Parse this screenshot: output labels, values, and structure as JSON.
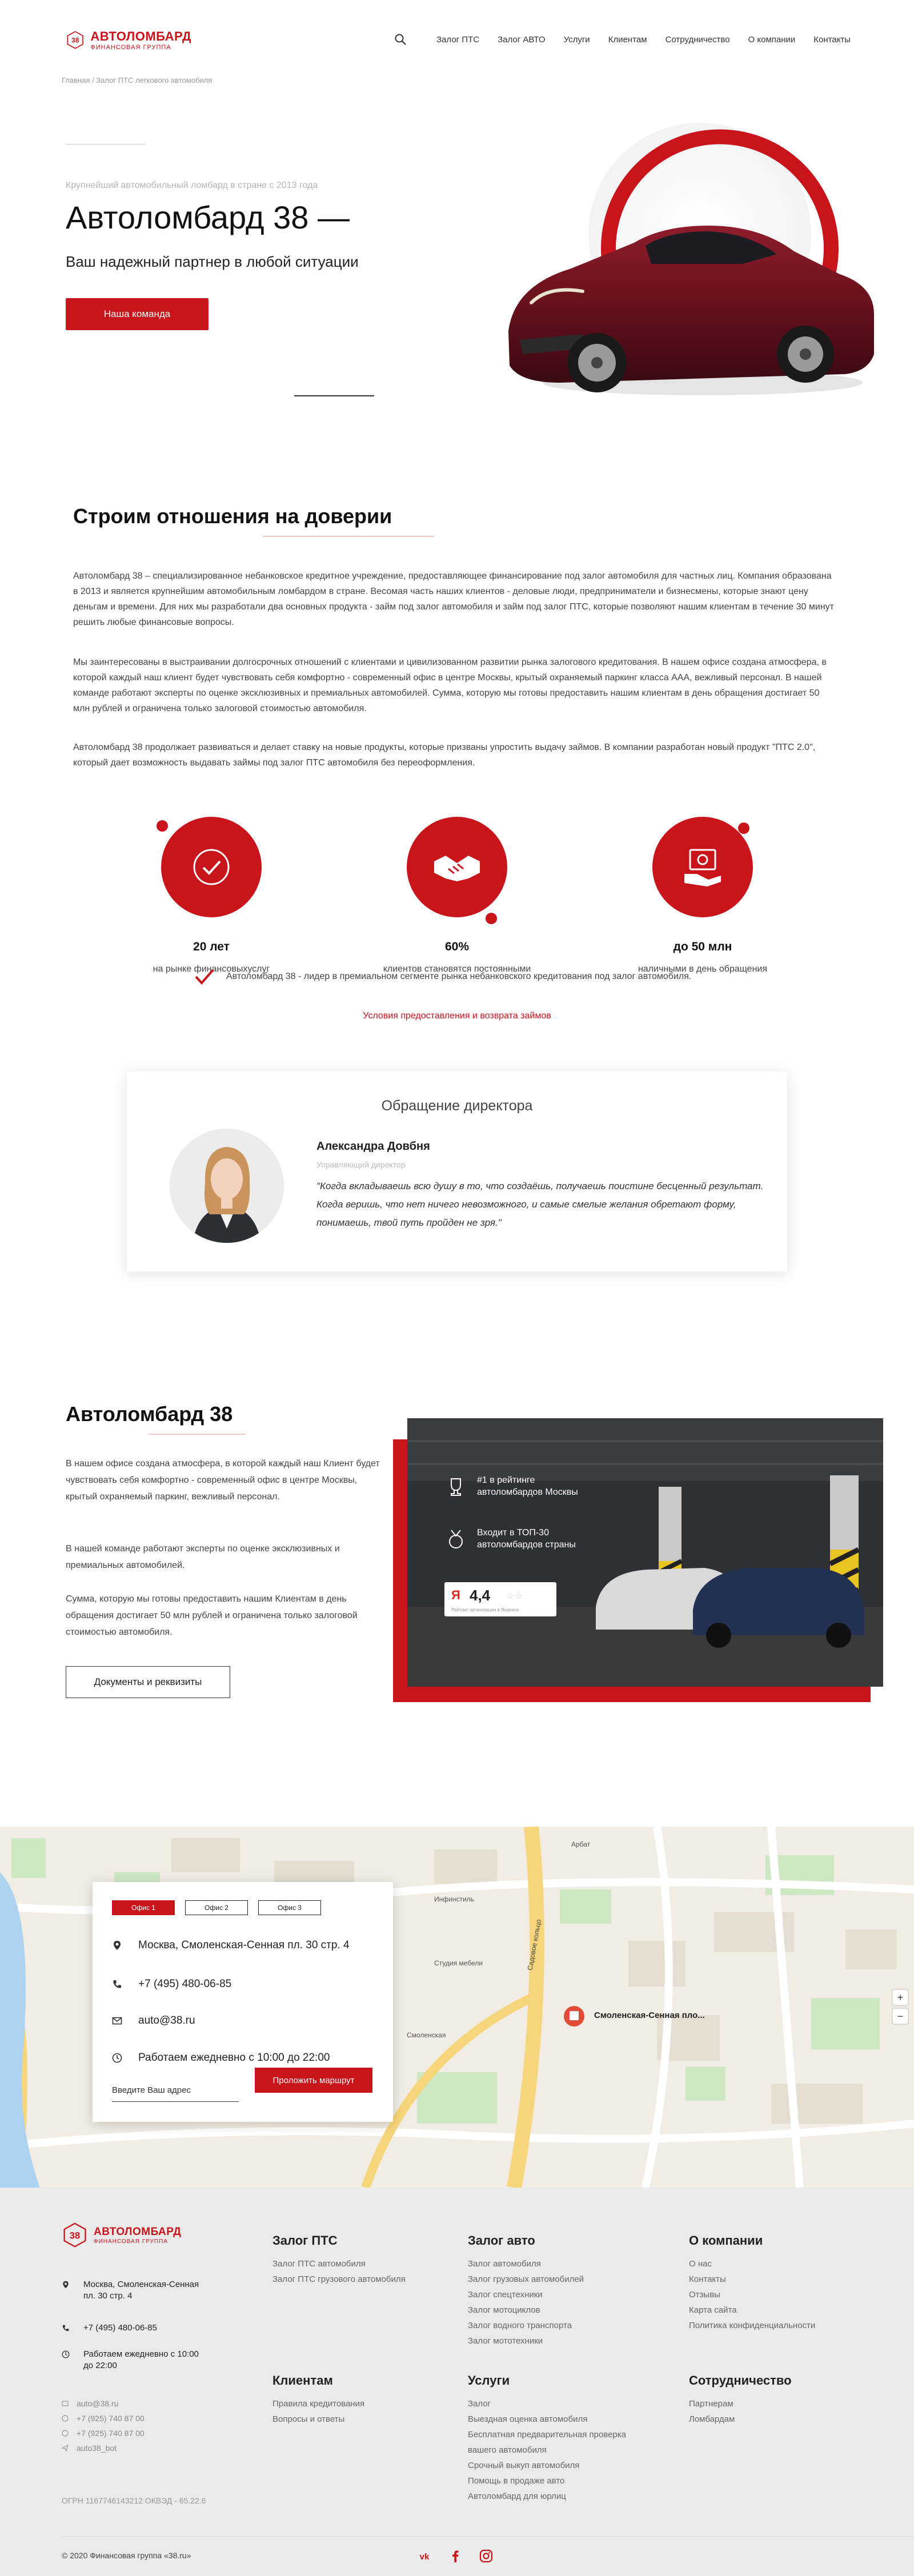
{
  "header": {
    "logo_title": "АВТОЛОМБАРД",
    "logo_subtitle": "ФИНАНСОВАЯ ГРУППА",
    "nav": [
      "Залог ПТС",
      "Залог АВТО",
      "Услуги",
      "Клиентам",
      "Сотрудничество",
      "О компании",
      "Контакты"
    ]
  },
  "breadcrumb": "Главная / Залог ПТС легкового автомобиля",
  "hero": {
    "kicker": "Крупнейший автомобильный ломбард в стране с 2013 года",
    "title": "Автоломбард 38 —",
    "subtitle": "Ваш надежный партнер в любой ситуации",
    "button": "Наша команда"
  },
  "about": {
    "title": "Строим отношения на доверии",
    "p1": "Автоломбард 38 – специализированное небанковское кредитное учреждение, предоставляющее финансирование под залог автомобиля для частных лиц. Компания образована в 2013 и является крупнейшим автомобильным ломбардом в стране. Весомая часть наших клиентов - деловые люди, предприниматели и бизнесмены, которые знают цену деньгам и времени. Для них мы разработали два основных продукта - займ под залог автомобиля и займ под залог ПТС, которые позволяют нашим клиентам в течение 30 минут решить любые финансовые вопросы.",
    "p2": "Мы заинтересованы в выстраивании долгосрочных отношений с клиентами и цивилизованном развитии рынка залогового кредитования. В нашем офисе создана атмосфера, в которой каждый наш клиент будет чувствовать себя комфортно - современный офис в центре Москвы, крытый охраняемый паркинг класса ААА, вежливый персонал. В нашей команде работают эксперты по оценке эксклюзивных и премиальных автомобилей. Сумма, которую мы готовы предоставить нашим клиентам в день обращения достигает 50 млн рублей и ограничена только залоговой стоимостью автомобиля.",
    "p3": "Автоломбард 38 продолжает развиваться и делает ставку на новые продукты, которые призваны упростить выдачу займов. В компании разработан новый продукт \"ПТС 2.0\", который дает возможность выдавать займы под залог ПТС автомобиля без переоформления.",
    "stats": [
      {
        "value": "20 лет",
        "label": "на рынке финансовыхуслуг"
      },
      {
        "value": "60%",
        "label": "клиентов становятся постоянными"
      },
      {
        "value": "до 50 млн",
        "label": "наличными в день обращения"
      }
    ],
    "check_text": "Автоломбард 38 - лидер в премиальном сегменте рынка небанковского кредитования под залог автомобиля.",
    "conditions_link": "Условия предоставления и возврата займов"
  },
  "director": {
    "heading": "Обращение директора",
    "name": "Александра Довбня",
    "role": "Управляющий директор",
    "quote": "\"Когда вкладываешь всю душу в то, что создаёшь, получаешь поистине бесценный результат. Когда веришь, что нет ничего невозможного, и самые смелые желания обретают форму, понимаешь, твой путь пройден не зря.\""
  },
  "pawnshop": {
    "title": "Автоломбард 38",
    "p1": "В нашем офисе создана атмосфера, в которой каждый наш Клиент будет чувствовать себя комфортно - современный офис в центре Москвы, крытый охраняемый паркинг, вежливый персонал.",
    "p2": "В нашей команде работают эксперты по оценке эксклюзивных и премиальных автомобилей.",
    "p3": "Сумма, которую мы готовы предоставить нашим Клиентам в день обращения достигает 50 млн рублей и ограничена только залоговой стоимостью автомобиля.",
    "docs_button": "Документы и реквизиты",
    "badge1": "#1 в рейтинге автоломбардов Москвы",
    "badge2": "Входит в ТОП-30 автоломбардов страны",
    "rating_value": "4,4",
    "rating_caption": "Рейтинг организации в Яндексе"
  },
  "offices": {
    "tabs": [
      "Офис 1",
      "Офис 2",
      "Офис 3"
    ],
    "address": "Москва, Смоленская-Сенная пл. 30 стр. 4",
    "phone": "+7 (495) 480-06-85",
    "email": "auto@38.ru",
    "hours": "Работаем ежедневно с 10:00 до 22:00",
    "input_placeholder": "Введите Ваш адрес",
    "route_button": "Проложить маршрут",
    "map_marker": "Смоленская-Сенная пло..."
  },
  "map_labels": {
    "street1": "Смоленская-Сенная площадь",
    "street2": "Садовое кольцо",
    "place1": "Инфинстиль",
    "place2": "Студия мебели",
    "place3": "Смоленская",
    "place4": "Арбат"
  },
  "footer": {
    "address": "Москва, Смоленская-Сенная пл. 30 стр. 4",
    "phone": "+7 (495) 480-06-85",
    "hours": "Работаем ежедневно с 10:00 до 22:00",
    "small_contacts": [
      "auto@38.ru",
      "+7 (925) 740 87 00",
      "+7 (925) 740 87 00",
      "auto38_bot"
    ],
    "ogrn": "ОГРН 1167746143212 ОКВЭД - 65.22.6",
    "copyright": "© 2020 Финансовая группа «38.ru»",
    "cols": [
      {
        "title": "Залог ПТС",
        "links": [
          "Залог ПТС автомобиля",
          "Залог ПТС грузового автомобиля"
        ]
      },
      {
        "title": "Залог авто",
        "links": [
          "Залог автомобиля",
          "Залог грузовых автомобилей",
          "Залог спецтехники",
          "Залог мотоциклов",
          "Залог водного транспорта",
          "Залог мототехники"
        ]
      },
      {
        "title": "О компании",
        "links": [
          "О нас",
          "Контакты",
          "Отзывы",
          "Карта сайта",
          "Политика конфиденциальности"
        ]
      },
      {
        "title": "Клиентам",
        "links": [
          "Правила кредитования",
          "Вопросы и ответы"
        ]
      },
      {
        "title": "Услуги",
        "links": [
          "Залог",
          "Выездная оценка автомобиля",
          "Бесплатная предварительная проверка вашего автомобиля",
          "Срочный выкуп автомобиля",
          "Помощь в продаже авто",
          "Автоломбард для юрлиц"
        ]
      },
      {
        "title": "Сотрудничество",
        "links": [
          "Партнерам",
          "Ломбардам"
        ]
      }
    ]
  },
  "colors": {
    "accent": "#c8141a",
    "footer_bg": "#eaeaea",
    "map_bg": "#f1ede4"
  }
}
